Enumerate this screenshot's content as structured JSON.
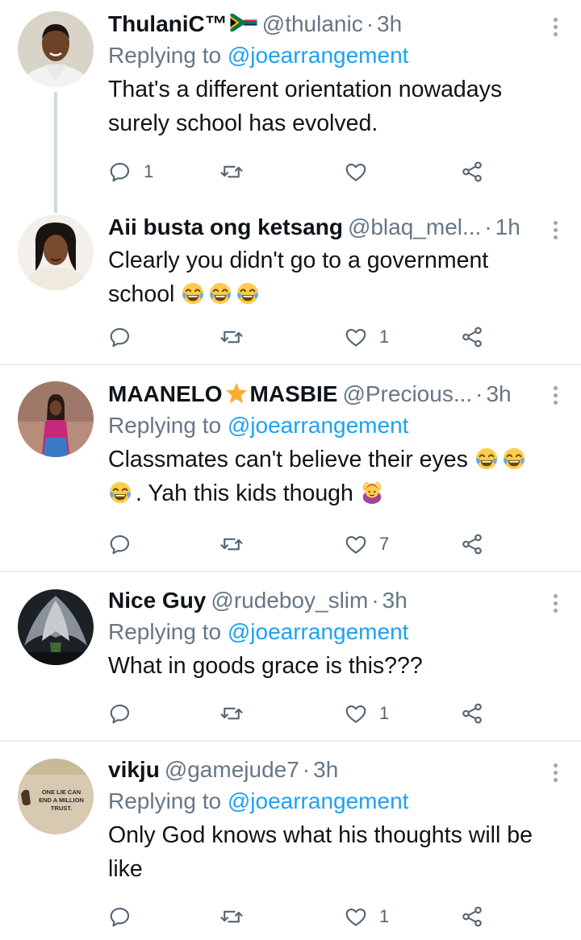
{
  "tweets": [
    {
      "name": "ThulaniC™",
      "handle": "@thulanic",
      "time": "3h",
      "dot": "·",
      "reply_prefix": "Replying to",
      "reply_to": "@joearrangement",
      "text_lines": [
        "That's a different orientation nowadays",
        "surely school has evolved."
      ],
      "reply_count": "1",
      "like_count": ""
    },
    {
      "name": "Aii busta ong ketsang",
      "handle": "@blaq_mel...",
      "time": "1h",
      "dot": "·",
      "text_lines": [
        "Clearly you didn't go to a government",
        "school"
      ],
      "reply_count": "",
      "like_count": "1"
    },
    {
      "name_part1": "MAANELO",
      "name_part2": "MASBIE",
      "handle": "@Precious...",
      "time": "3h",
      "dot": "·",
      "reply_prefix": "Replying to",
      "reply_to": "@joearrangement",
      "text_line1": "Classmates can't believe their eyes",
      "text_line2": ". Yah this kids though",
      "reply_count": "",
      "like_count": "7"
    },
    {
      "name": "Nice Guy",
      "handle": "@rudeboy_slim",
      "time": "3h",
      "dot": "·",
      "reply_prefix": "Replying to",
      "reply_to": "@joearrangement",
      "text_lines": [
        "What in goods grace is this???"
      ],
      "reply_count": "",
      "like_count": "1"
    },
    {
      "name": "vikju",
      "handle": "@gamejude7",
      "time": "3h",
      "dot": "·",
      "reply_prefix": "Replying to",
      "reply_to": "@joearrangement",
      "text_lines": [
        "Only God knows what his thoughts will be",
        "like"
      ],
      "avatar_text": [
        "ONE LIE CAN",
        "END A MILLION",
        "TRUST."
      ],
      "reply_count": "",
      "like_count": "1"
    }
  ],
  "colors": {
    "link": "#1da1f2",
    "muted": "#657786",
    "divider": "#e6ecf0",
    "icon": "#536471"
  },
  "icons": [
    "reply-icon",
    "retweet-icon",
    "like-icon",
    "share-icon",
    "more-icon",
    "face-with-tears-of-joy-icon",
    "person-gesturing-ok-icon",
    "south-africa-flag-icon",
    "star-icon"
  ]
}
